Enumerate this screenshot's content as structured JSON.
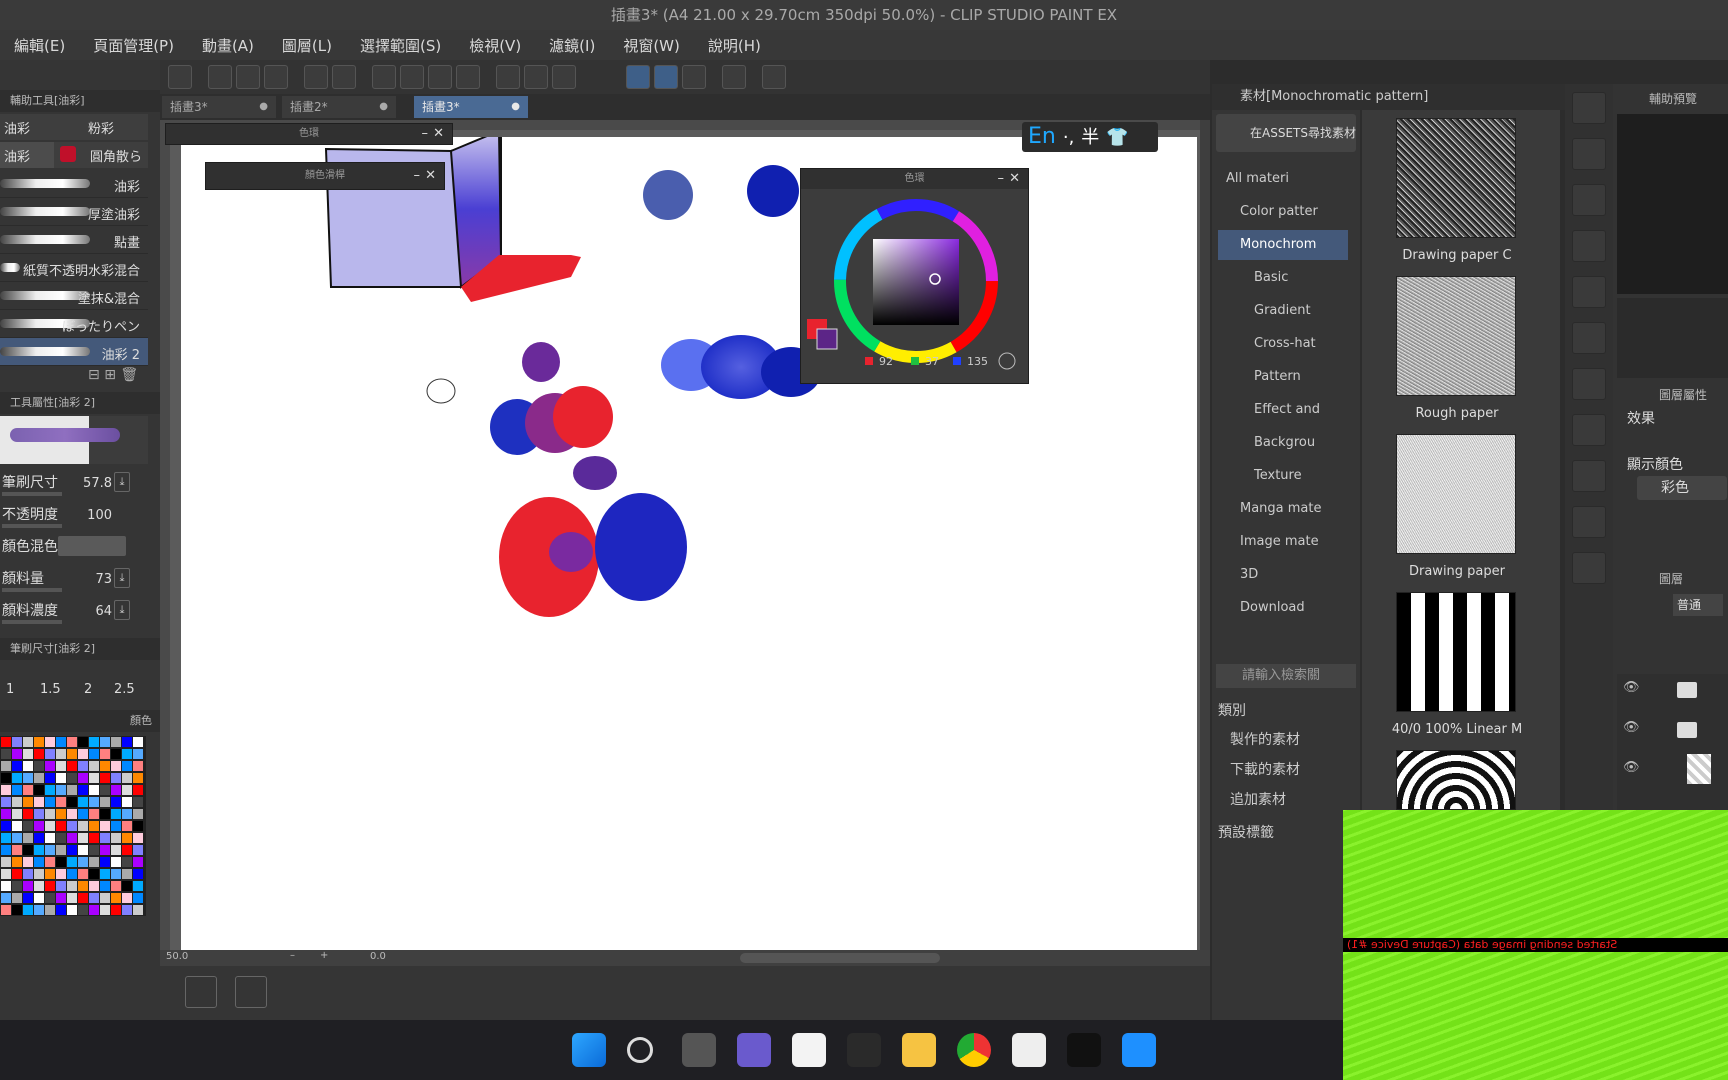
{
  "window": {
    "title": "插畫3* (A4 21.00 x 29.70cm 350dpi 50.0%) - CLIP STUDIO PAINT EX"
  },
  "menu": [
    "編輯(E)",
    "頁面管理(P)",
    "動畫(A)",
    "圖層(L)",
    "選擇範圍(S)",
    "檢視(V)",
    "濾鏡(I)",
    "視窗(W)",
    "說明(H)"
  ],
  "tabs": [
    {
      "label": "插畫3*",
      "active": false
    },
    {
      "label": "插畫2*",
      "active": false
    },
    {
      "label": "插畫3*",
      "active": true
    }
  ],
  "left": {
    "subtool_header": "輔助工具[油彩]",
    "subtool_tabs": [
      "油彩",
      "粉彩"
    ],
    "subtool_tabs2": [
      "油彩",
      "圓角散ら"
    ],
    "brushes": [
      "油彩",
      "厚塗油彩",
      "點畫",
      "紙質不透明水彩混合",
      "塗抹&混合",
      "ぼったりペン",
      "油彩 2"
    ],
    "props_header": "工具屬性[油彩 2]",
    "props": [
      {
        "label": "筆刷尺寸",
        "value": "57.8"
      },
      {
        "label": "不透明度",
        "value": "100"
      },
      {
        "label": "顏色混色",
        "value": ""
      },
      {
        "label": "顏料量",
        "value": "73"
      },
      {
        "label": "顏料濃度",
        "value": "64"
      }
    ],
    "brushsize_header": "筆刷尺寸[油彩 2]",
    "brushsize_values": [
      "1",
      "1.5",
      "2",
      "2.5"
    ],
    "palette_header": "顏色"
  },
  "floating_panels": {
    "color_set_title": "色環",
    "navigator_title": "顏色滑桿",
    "color_wheel_title": "色環",
    "rgb": {
      "r": "92",
      "g": "37",
      "b": "135"
    }
  },
  "ime": {
    "lang": "En",
    "punct": "·,",
    "width": "半"
  },
  "materials": {
    "header": "素材[Monochromatic pattern]",
    "search_assets": "在ASSETS尋找素材",
    "tree": [
      {
        "label": "All materi",
        "selected": false,
        "indent": 0
      },
      {
        "label": "Color patter",
        "selected": false,
        "indent": 1
      },
      {
        "label": "Monochrom",
        "selected": true,
        "indent": 1
      },
      {
        "label": "Basic",
        "selected": false,
        "indent": 2
      },
      {
        "label": "Gradient",
        "selected": false,
        "indent": 2
      },
      {
        "label": "Cross-hat",
        "selected": false,
        "indent": 2
      },
      {
        "label": "Pattern",
        "selected": false,
        "indent": 2
      },
      {
        "label": "Effect and",
        "selected": false,
        "indent": 2
      },
      {
        "label": "Backgrou",
        "selected": false,
        "indent": 2
      },
      {
        "label": "Texture",
        "selected": false,
        "indent": 2
      },
      {
        "label": "Manga mate",
        "selected": false,
        "indent": 1
      },
      {
        "label": "Image mate",
        "selected": false,
        "indent": 1
      },
      {
        "label": "3D",
        "selected": false,
        "indent": 1
      },
      {
        "label": "Download",
        "selected": false,
        "indent": 1
      }
    ],
    "search_placeholder": "請輸入檢索關",
    "category_label": "類別",
    "categories": [
      "製作的素材",
      "下載的素材",
      "追加素材"
    ],
    "preset_tags": "預設標籤",
    "thumbs": [
      {
        "label": "Drawing paper C"
      },
      {
        "label": "Rough paper"
      },
      {
        "label": "Drawing paper"
      },
      {
        "label": "40/0 100% Linear M"
      },
      {
        "label": ""
      }
    ]
  },
  "right": {
    "nav_label": "輔助預覽",
    "layer_prop": "圖層屬性",
    "effect": "效果",
    "display_color": "顯示顏色",
    "color_mode": "彩色",
    "layer_label": "圖層",
    "blend": "普通"
  },
  "status": {
    "zoom": "50.0",
    "angle": "0.0"
  },
  "capture_text": "Started sending image data (Capture Device #1)",
  "colors": {
    "main": "#e8232e",
    "sub": "#5c2587",
    "selection": "#44597a"
  }
}
